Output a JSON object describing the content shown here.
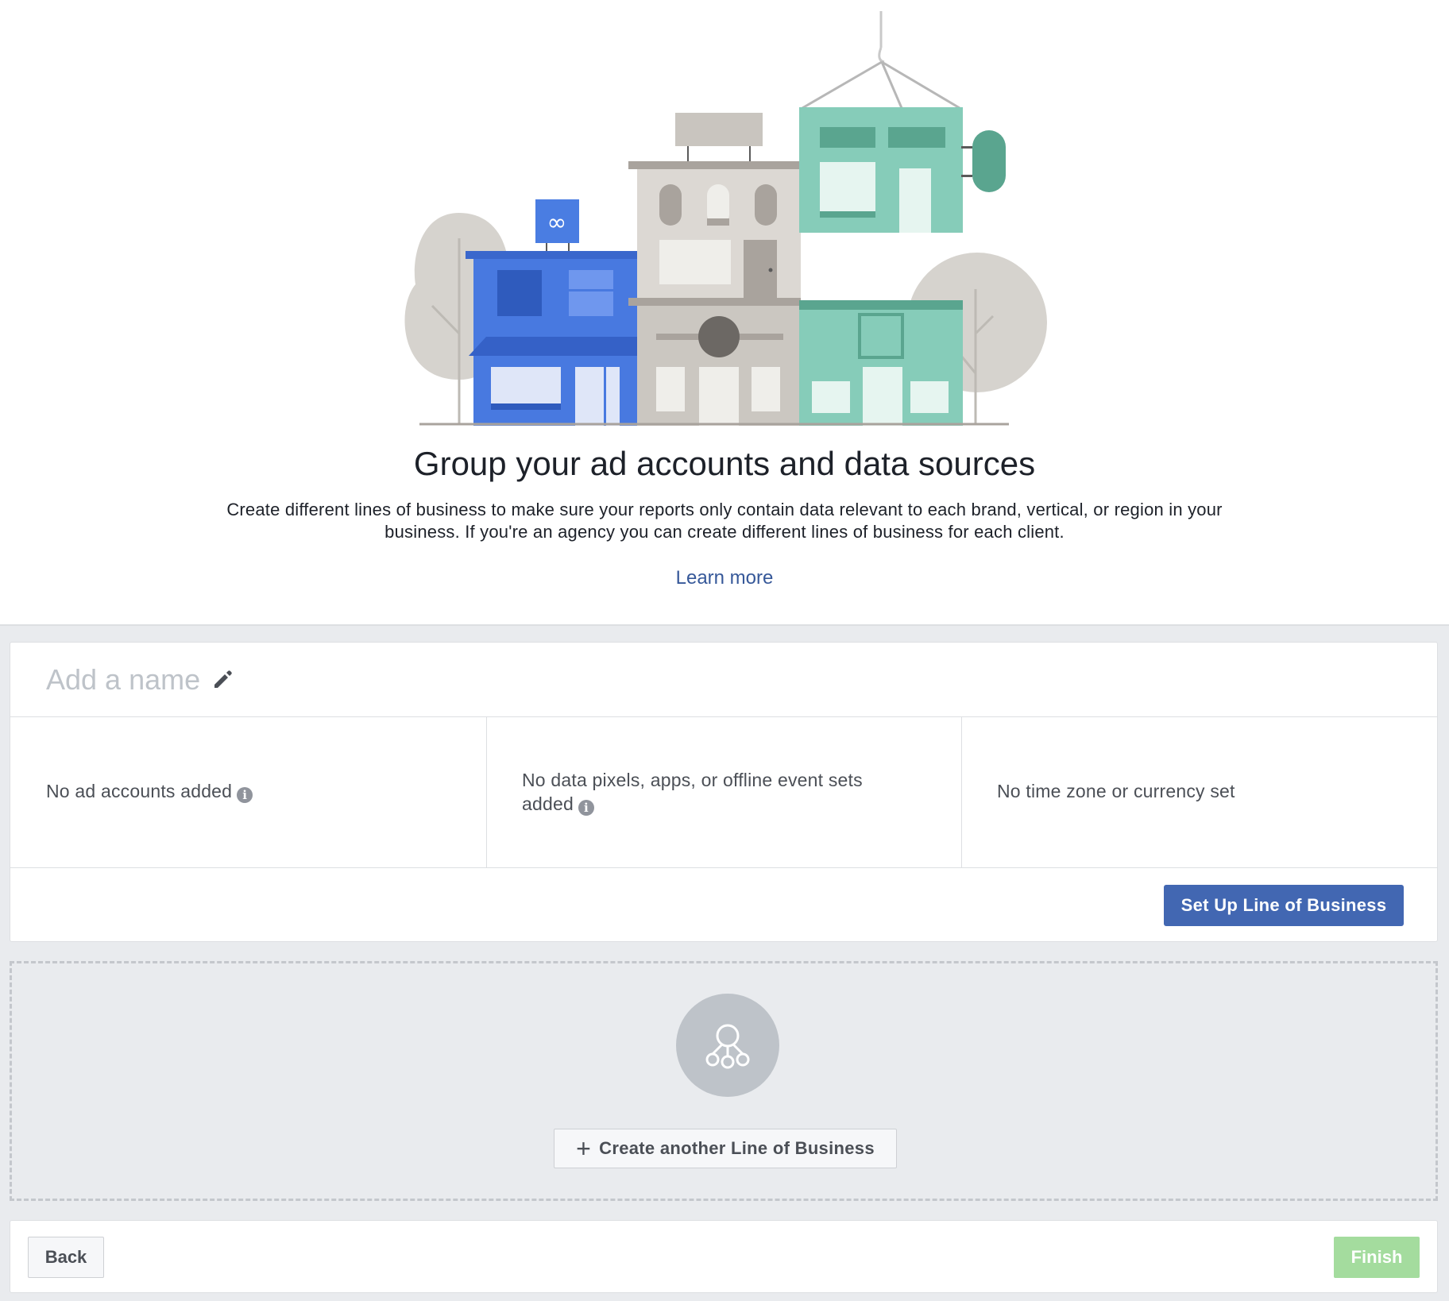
{
  "hero": {
    "title": "Group your ad accounts and data sources",
    "description": "Create different lines of business to make sure your reports only contain data relevant to each brand, vertical, or region in your business. If you're an agency you can create different lines of business for each client.",
    "learn_more": "Learn more"
  },
  "card": {
    "name_placeholder": "Add a name",
    "columns": [
      {
        "text": "No ad accounts added",
        "icon": "info-icon"
      },
      {
        "text": "No data pixels, apps, or offline event sets added",
        "icon": "info-icon"
      },
      {
        "text": "No time zone or currency set"
      }
    ],
    "setup_button": "Set Up Line of Business"
  },
  "create_another": {
    "icon": "business-network-icon",
    "button_label": "Create another Line of Business"
  },
  "footer": {
    "back_label": "Back",
    "finish_label": "Finish"
  },
  "colors": {
    "primary": "#4267b2",
    "link": "#365899",
    "finish_disabled": "#a4dc9e",
    "page_bg": "#e9ebee"
  }
}
